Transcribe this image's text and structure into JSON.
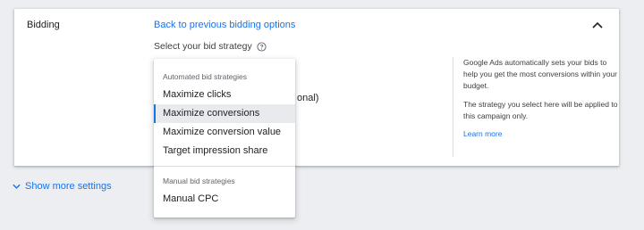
{
  "bidding": {
    "section_title": "Bidding",
    "back_link": "Back to previous bidding options",
    "strategy_label": "Select your bid strategy",
    "hidden_fragment": "onal)"
  },
  "help_panel": {
    "paragraph1": "Google Ads automatically sets your bids to help you get the most conversions within your budget.",
    "paragraph2": "The strategy you select here will be applied to this campaign only.",
    "learn_more": "Learn more"
  },
  "menu": {
    "automated_header": "Automated bid strategies",
    "automated_items": [
      {
        "label": "Maximize clicks"
      },
      {
        "label": "Maximize conversions"
      },
      {
        "label": "Maximize conversion value"
      },
      {
        "label": "Target impression share"
      }
    ],
    "manual_header": "Manual bid strategies",
    "manual_items": [
      {
        "label": "Manual CPC"
      }
    ],
    "selected": "Maximize conversions"
  },
  "show_more": "Show more settings",
  "colors": {
    "accent": "#1a73e8",
    "background": "#eceef1",
    "selected_bg": "#e8eaed"
  }
}
